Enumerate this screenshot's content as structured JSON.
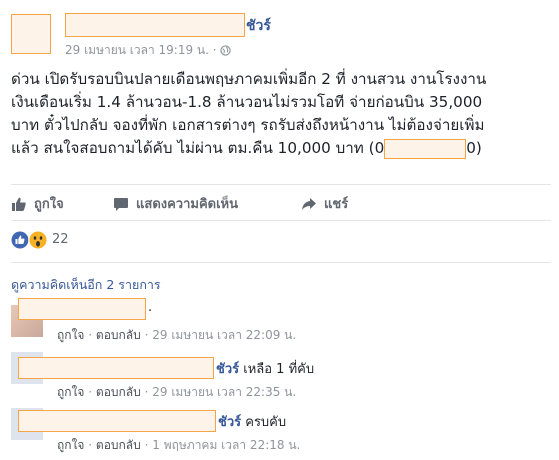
{
  "post": {
    "author_suffix": "ชัวร์",
    "timestamp": "29 เมษายน เวลา 19:19 น.",
    "meta_separator": "·",
    "text_line1": "ด่วน เปิดรับรอบบินปลายเดือนพฤษภาคมเพิ่มอีก 2 ที่ งานสวน งานโรงงาน",
    "text_line2": "เงินเดือนเริ่ม 1.4 ล้านวอน-1.8 ล้านวอนไม่รวมโอที จ่ายก่อนบิน 35,000",
    "text_line3": "บาท ตั๋วไปกลับ จองที่พัก เอกสารต่างๆ รถรับส่งถึงหน้างาน ไม่ต้องจ่ายเพิ่ม",
    "text_line4_pre": "แล้ว สนใจสอบถามได้คับ ไม่ผ่าน ตม.คืน 10,000 บาท (0",
    "text_line4_post": "0)"
  },
  "actions": {
    "like": "ถูกใจ",
    "comment": "แสดงความคิดเห็น",
    "share": "แชร์"
  },
  "reactions": {
    "count": "22",
    "icons": [
      "like-icon",
      "wow-icon"
    ]
  },
  "more_comments": "ดูความคิดเห็นอีก 2 รายการ",
  "comments": [
    {
      "name_suffix": "",
      "text": ".",
      "like": "ถูกใจ",
      "reply": "ตอบกลับ",
      "sep": "·",
      "time": "29 เมษายน เวลา 22:09 น."
    },
    {
      "name_suffix": "ชัวร์",
      "text": "เหลือ 1 ที่คับ",
      "like": "ถูกใจ",
      "reply": "ตอบกลับ",
      "sep": "·",
      "time": "29 เมษายน เวลา 22:35 น."
    },
    {
      "name_suffix": "ชัวร์",
      "text": "ครบคับ",
      "like": "ถูกใจ",
      "reply": "ตอบกลับ",
      "sep": "·",
      "time": "1 พฤษภาคม เวลา 22:18 น."
    }
  ],
  "colors": {
    "link": "#365899",
    "muted": "#90949c",
    "like_blue": "#4267b2",
    "wow_yellow": "#f7b125",
    "redaction_border": "#f5a545"
  }
}
